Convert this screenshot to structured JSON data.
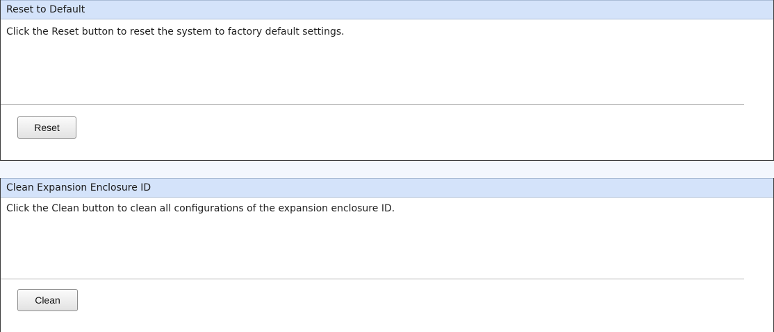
{
  "reset_section": {
    "title": "Reset to Default",
    "description": "Click the Reset button to reset the system to factory default settings.",
    "button_label": "Reset"
  },
  "clean_section": {
    "title": "Clean Expansion Enclosure ID",
    "description": "Click the Clean button to clean all configurations of the expansion enclosure ID.",
    "button_label": "Clean"
  },
  "colors": {
    "header_background": "#d4e3fa",
    "panel_border": "#3c3c3c",
    "separator": "#b4b4b4"
  }
}
